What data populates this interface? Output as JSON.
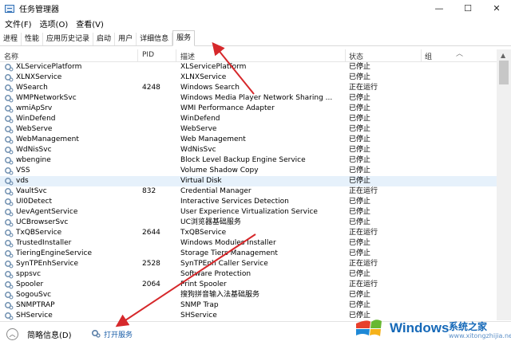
{
  "window": {
    "title": "任务管理器",
    "minimize": "—",
    "maximize": "☐",
    "close": "✕"
  },
  "menu": [
    "文件(F)",
    "选项(O)",
    "查看(V)"
  ],
  "tabs": [
    "进程",
    "性能",
    "应用历史记录",
    "启动",
    "用户",
    "详细信息",
    "服务"
  ],
  "active_tab": "服务",
  "columns": {
    "name": "名称",
    "pid": "PID",
    "desc": "描述",
    "status": "状态",
    "group": "组"
  },
  "services": [
    {
      "name": "XLServicePlatform",
      "pid": "",
      "desc": "XLServicePlatform",
      "status": "已停止"
    },
    {
      "name": "XLNXService",
      "pid": "",
      "desc": "XLNXService",
      "status": "已停止"
    },
    {
      "name": "WSearch",
      "pid": "4248",
      "desc": "Windows Search",
      "status": "正在运行"
    },
    {
      "name": "WMPNetworkSvc",
      "pid": "",
      "desc": "Windows Media Player Network Sharing ...",
      "status": "已停止"
    },
    {
      "name": "wmiApSrv",
      "pid": "",
      "desc": "WMI Performance Adapter",
      "status": "已停止"
    },
    {
      "name": "WinDefend",
      "pid": "",
      "desc": "WinDefend",
      "status": "已停止"
    },
    {
      "name": "WebServe",
      "pid": "",
      "desc": "WebServe",
      "status": "已停止"
    },
    {
      "name": "WebManagement",
      "pid": "",
      "desc": "Web Management",
      "status": "已停止"
    },
    {
      "name": "WdNisSvc",
      "pid": "",
      "desc": "WdNisSvc",
      "status": "已停止"
    },
    {
      "name": "wbengine",
      "pid": "",
      "desc": "Block Level Backup Engine Service",
      "status": "已停止"
    },
    {
      "name": "VSS",
      "pid": "",
      "desc": "Volume Shadow Copy",
      "status": "已停止"
    },
    {
      "name": "vds",
      "pid": "",
      "desc": "Virtual Disk",
      "status": "已停止"
    },
    {
      "name": "VaultSvc",
      "pid": "832",
      "desc": "Credential Manager",
      "status": "正在运行"
    },
    {
      "name": "UI0Detect",
      "pid": "",
      "desc": "Interactive Services Detection",
      "status": "已停止"
    },
    {
      "name": "UevAgentService",
      "pid": "",
      "desc": "User Experience Virtualization Service",
      "status": "已停止"
    },
    {
      "name": "UCBrowserSvc",
      "pid": "",
      "desc": "UC浏览器基础服务",
      "status": "已停止"
    },
    {
      "name": "TxQBService",
      "pid": "2644",
      "desc": "TxQBService",
      "status": "正在运行"
    },
    {
      "name": "TrustedInstaller",
      "pid": "",
      "desc": "Windows Modules Installer",
      "status": "已停止"
    },
    {
      "name": "TieringEngineService",
      "pid": "",
      "desc": "Storage Tiers Management",
      "status": "已停止"
    },
    {
      "name": "SynTPEnhService",
      "pid": "2528",
      "desc": "SynTPEnh Caller Service",
      "status": "正在运行"
    },
    {
      "name": "sppsvc",
      "pid": "",
      "desc": "Software Protection",
      "status": "已停止"
    },
    {
      "name": "Spooler",
      "pid": "2064",
      "desc": "Print Spooler",
      "status": "正在运行"
    },
    {
      "name": "SogouSvc",
      "pid": "",
      "desc": "搜狗拼音输入法基础服务",
      "status": "已停止"
    },
    {
      "name": "SNMPTRAP",
      "pid": "",
      "desc": "SNMP Trap",
      "status": "已停止"
    },
    {
      "name": "SHService",
      "pid": "",
      "desc": "SHService",
      "status": "已停止"
    }
  ],
  "selected_service": "vds",
  "footer": {
    "fewer_details": "简略信息(D)",
    "open_services": "打开服务"
  },
  "watermark": {
    "brand": "Windows",
    "site": "系统之家",
    "url": "www.xitongzhijia.net"
  },
  "colors": {
    "arrow": "#d6282b",
    "selection": "#e6f1fb",
    "brand": "#1669b8"
  },
  "icons": {
    "service": "gear-icon",
    "fewer": "chevron-up-icon",
    "app": "task-manager-icon"
  }
}
